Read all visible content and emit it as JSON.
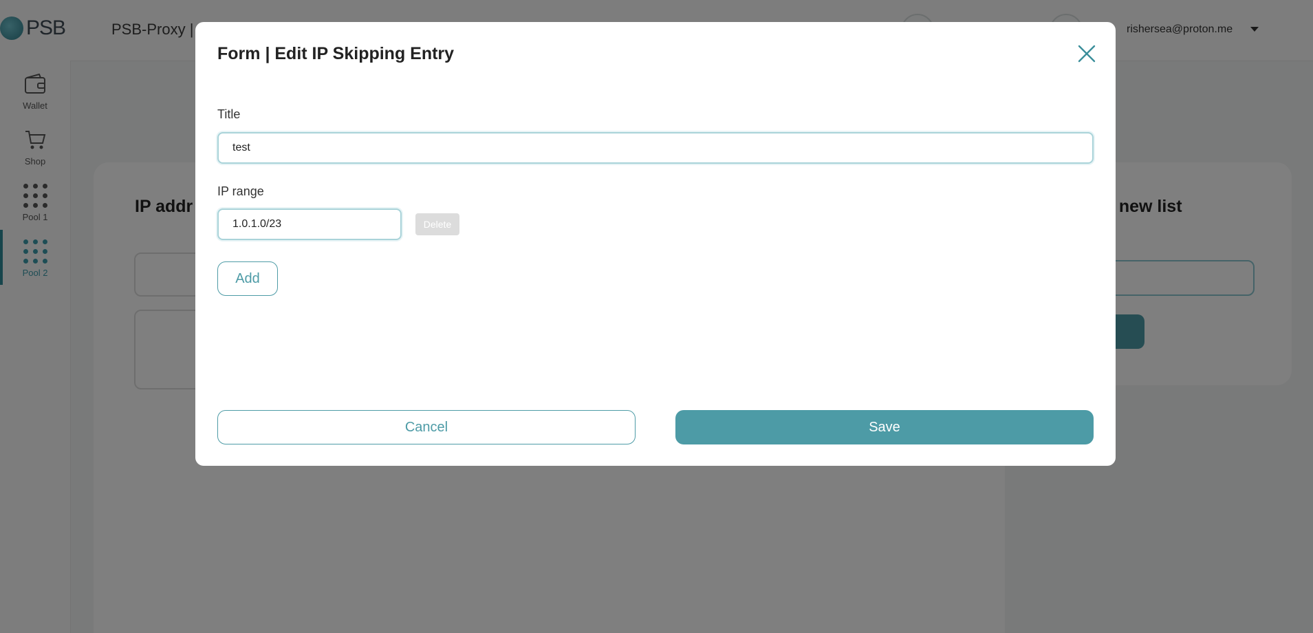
{
  "header": {
    "logo_text": "PSB",
    "app_title": "PSB-Proxy |",
    "user_email": "rishersea@proton.me"
  },
  "sidebar": {
    "items": [
      {
        "label": "Wallet",
        "icon": "wallet-icon"
      },
      {
        "label": "Shop",
        "icon": "cart-icon"
      },
      {
        "label": "Pool 1",
        "icon": "grid-dots-icon"
      },
      {
        "label": "Pool 2",
        "icon": "grid-dots-icon",
        "active": true
      }
    ]
  },
  "background": {
    "main_card_title": "IP addr",
    "right_card_title": "e new list"
  },
  "modal": {
    "title": "Form | Edit IP Skipping Entry",
    "title_field": {
      "label": "Title",
      "value": "test"
    },
    "ip_range_field": {
      "label": "IP range",
      "value": "1.0.1.0/23"
    },
    "delete_label": "Delete",
    "add_label": "Add",
    "cancel_label": "Cancel",
    "save_label": "Save"
  },
  "colors": {
    "accent": "#4d9ba6",
    "overlay": "rgba(0,0,0,0.5)"
  }
}
